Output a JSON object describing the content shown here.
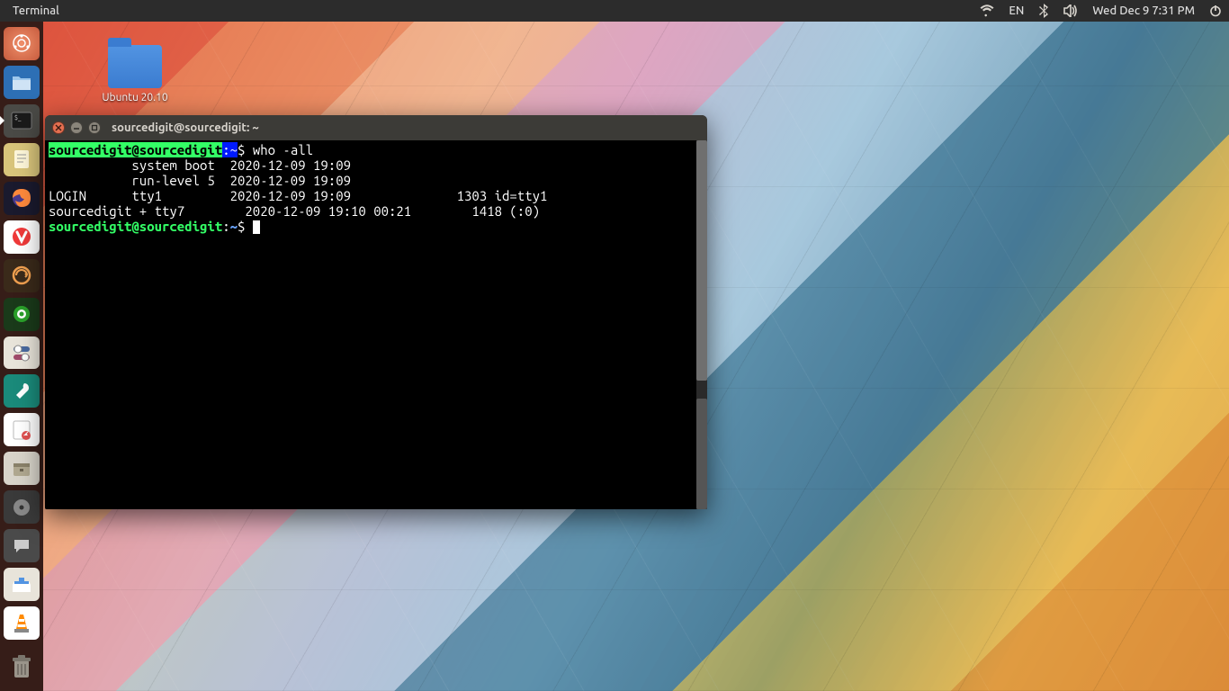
{
  "top_panel": {
    "app_title": "Terminal",
    "lang": "EN",
    "datetime": "Wed Dec  9 7:31 PM"
  },
  "desktop": {
    "folder_label": "Ubuntu 20.10"
  },
  "terminal": {
    "window_title": "sourcedigit@sourcedigit: ~",
    "prompt1": {
      "userhost": "sourcedigit@sourcedigit",
      "path": "~",
      "command": "who -all"
    },
    "output_lines": [
      "           system boot  2020-12-09 19:09",
      "           run-level 5  2020-12-09 19:09",
      "LOGIN      tty1         2020-12-09 19:09              1303 id=tty1",
      "sourcedigit + tty7        2020-12-09 19:10 00:21        1418 (:0)"
    ],
    "prompt2": {
      "userhost": "sourcedigit@sourcedigit",
      "path": "~"
    }
  },
  "launcher_items": [
    {
      "name": "dash",
      "active": false
    },
    {
      "name": "files",
      "active": false
    },
    {
      "name": "terminal",
      "active": true
    },
    {
      "name": "text-editor",
      "active": false
    },
    {
      "name": "firefox",
      "active": false
    },
    {
      "name": "vivaldi",
      "active": false
    },
    {
      "name": "sync",
      "active": false
    },
    {
      "name": "shutter",
      "active": false
    },
    {
      "name": "settings",
      "active": false
    },
    {
      "name": "tweaks",
      "active": false
    },
    {
      "name": "notes",
      "active": false
    },
    {
      "name": "archive",
      "active": false
    },
    {
      "name": "disks",
      "active": false
    },
    {
      "name": "chat",
      "active": false
    },
    {
      "name": "software",
      "active": false
    },
    {
      "name": "vlc",
      "active": false
    }
  ]
}
